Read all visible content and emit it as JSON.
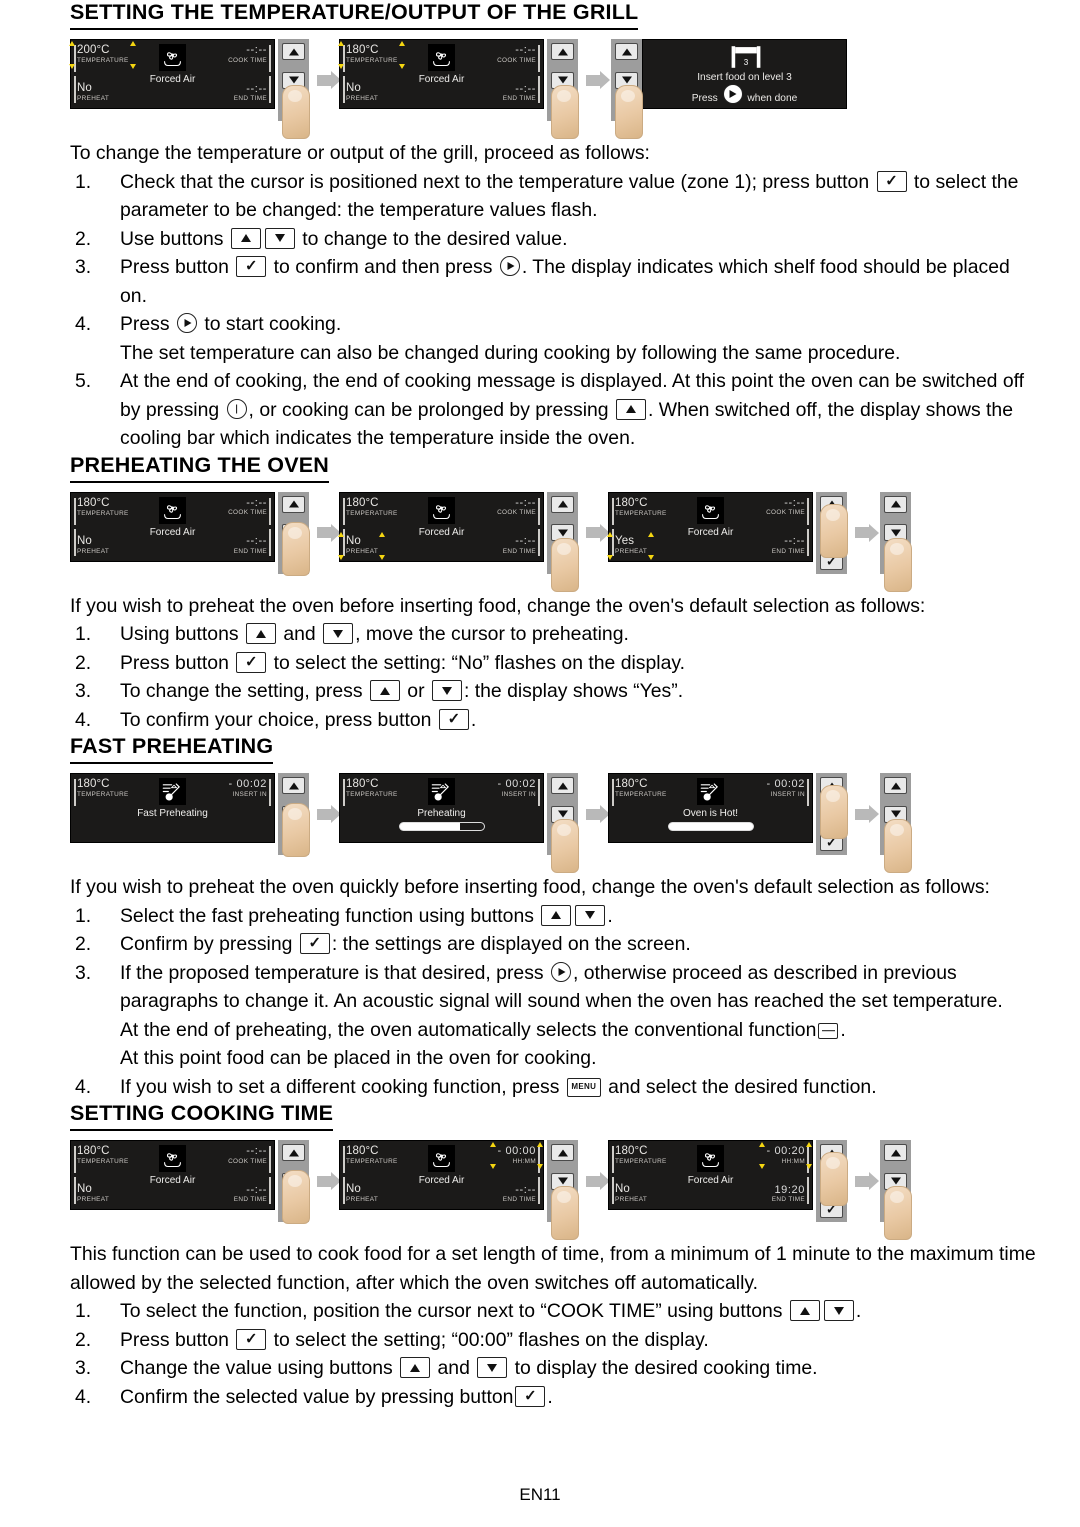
{
  "page": {
    "footer": "EN11"
  },
  "sections": [
    {
      "id": "grill",
      "title": "SETTING THE TEMPERATURE/OUTPUT OF THE GRILL",
      "intro": "To change the temperature or output of the grill, proceed as follows:",
      "steps": [
        {
          "parts": [
            {
              "t": "text",
              "v": "Check that the cursor is positioned next to the temperature value (zone 1); press button "
            },
            {
              "t": "key",
              "v": "ok-button"
            },
            {
              "t": "text",
              "v": " to select the parameter to be changed: the temperature values flash."
            }
          ]
        },
        {
          "parts": [
            {
              "t": "text",
              "v": "Use buttons "
            },
            {
              "t": "key",
              "v": "up-button"
            },
            {
              "t": "key",
              "v": "down-button"
            },
            {
              "t": "text",
              "v": " to change to the desired value."
            }
          ]
        },
        {
          "parts": [
            {
              "t": "text",
              "v": "Press button "
            },
            {
              "t": "key",
              "v": "ok-button"
            },
            {
              "t": "text",
              "v": " to confirm and then press "
            },
            {
              "t": "key",
              "v": "start-button"
            },
            {
              "t": "text",
              "v": ". The display indicates which shelf food should be placed on."
            }
          ]
        },
        {
          "parts": [
            {
              "t": "text",
              "v": "Press "
            },
            {
              "t": "key",
              "v": "start-button"
            },
            {
              "t": "text",
              "v": " to start cooking."
            },
            {
              "t": "br",
              "v": ""
            },
            {
              "t": "text",
              "v": "The set temperature can also be changed during cooking by following the same procedure."
            }
          ]
        },
        {
          "parts": [
            {
              "t": "text",
              "v": "At the end of cooking, the end of cooking message is displayed. At this point the oven can be switched off by pressing "
            },
            {
              "t": "key",
              "v": "power-button"
            },
            {
              "t": "text",
              "v": ", or cooking can be prolonged by pressing "
            },
            {
              "t": "key",
              "v": "up-button"
            },
            {
              "t": "text",
              "v": ". When switched off, the display shows the cooling bar which indicates the temperature inside the oven."
            }
          ]
        }
      ],
      "diagram": {
        "panels": [
          {
            "kind": "display",
            "temperature": "200°C",
            "temperature_label": "TEMPERATURE",
            "cook_time": "--:--",
            "cook_time_label": "COOK TIME",
            "preheat": "No",
            "preheat_label": "PREHEAT",
            "end_time": "--:--",
            "end_time_label": "END TIME",
            "function_icon": "forced-air-icon",
            "function_name": "Forced Air",
            "flash_on": "temperature"
          },
          {
            "kind": "buttons",
            "press": "ok-button"
          },
          {
            "kind": "arrow"
          },
          {
            "kind": "display",
            "temperature": "180°C",
            "temperature_label": "TEMPERATURE",
            "cook_time": "--:--",
            "cook_time_label": "COOK TIME",
            "preheat": "No",
            "preheat_label": "PREHEAT",
            "end_time": "--:--",
            "end_time_label": "END TIME",
            "function_icon": "forced-air-icon",
            "function_name": "Forced Air",
            "flash_on": "temperature"
          },
          {
            "kind": "buttons",
            "press": "ok-button"
          },
          {
            "kind": "arrow"
          },
          {
            "kind": "buttons",
            "press": "ok-button"
          },
          {
            "kind": "message",
            "icon": "shelf-level-icon",
            "line1": "Insert food on level 3",
            "line2_pre": "Press ",
            "line2_key": "start-button",
            "line2_post": " when done"
          }
        ]
      }
    },
    {
      "id": "preheat",
      "title": "PREHEATING THE OVEN",
      "intro": "If you wish to preheat the oven before inserting food, change the oven's default selection as follows:",
      "steps": [
        {
          "parts": [
            {
              "t": "text",
              "v": "Using buttons "
            },
            {
              "t": "key",
              "v": "up-button"
            },
            {
              "t": "text",
              "v": " and "
            },
            {
              "t": "key",
              "v": "down-button"
            },
            {
              "t": "text",
              "v": ", move the cursor to preheating."
            }
          ]
        },
        {
          "parts": [
            {
              "t": "text",
              "v": "Press button "
            },
            {
              "t": "key",
              "v": "ok-button"
            },
            {
              "t": "text",
              "v": " to select the setting: “No” flashes on the display."
            }
          ]
        },
        {
          "parts": [
            {
              "t": "text",
              "v": "To change the setting, press "
            },
            {
              "t": "key",
              "v": "up-button"
            },
            {
              "t": "text",
              "v": " or "
            },
            {
              "t": "key",
              "v": "down-button"
            },
            {
              "t": "text",
              "v": ": the display shows “Yes”."
            }
          ]
        },
        {
          "parts": [
            {
              "t": "text",
              "v": "To confirm your choice, press button "
            },
            {
              "t": "key",
              "v": "ok-button"
            },
            {
              "t": "text",
              "v": "."
            }
          ]
        }
      ],
      "diagram": {
        "panels": [
          {
            "kind": "display",
            "temperature": "180°C",
            "temperature_label": "TEMPERATURE",
            "cook_time": "--:--",
            "cook_time_label": "COOK TIME",
            "preheat": "No",
            "preheat_label": "PREHEAT",
            "end_time": "--:--",
            "end_time_label": "END TIME",
            "function_icon": "forced-air-icon",
            "function_name": "Forced Air",
            "flash_on": "none"
          },
          {
            "kind": "buttons",
            "press": "down-button"
          },
          {
            "kind": "arrow"
          },
          {
            "kind": "display",
            "temperature": "180°C",
            "temperature_label": "TEMPERATURE",
            "cook_time": "--:--",
            "cook_time_label": "COOK TIME",
            "preheat": "No",
            "preheat_label": "PREHEAT",
            "end_time": "--:--",
            "end_time_label": "END TIME",
            "function_icon": "forced-air-icon",
            "function_name": "Forced Air",
            "flash_on": "preheat"
          },
          {
            "kind": "buttons",
            "press": "ok-button"
          },
          {
            "kind": "arrow"
          },
          {
            "kind": "display",
            "temperature": "180°C",
            "temperature_label": "TEMPERATURE",
            "cook_time": "--:--",
            "cook_time_label": "COOK TIME",
            "preheat": "Yes",
            "preheat_label": "PREHEAT",
            "end_time": "--:--",
            "end_time_label": "END TIME",
            "function_icon": "forced-air-icon",
            "function_name": "Forced Air",
            "flash_on": "preheat"
          },
          {
            "kind": "buttons",
            "press": "up-button"
          },
          {
            "kind": "arrow"
          },
          {
            "kind": "buttons",
            "press": "ok-button"
          }
        ]
      }
    },
    {
      "id": "fastpreheat",
      "title": "FAST PREHEATING",
      "intro": "If you wish to preheat the oven quickly before inserting food, change the oven's default selection as follows:",
      "steps": [
        {
          "parts": [
            {
              "t": "text",
              "v": "Select the fast preheating function using buttons "
            },
            {
              "t": "key",
              "v": "up-button"
            },
            {
              "t": "key",
              "v": "down-button"
            },
            {
              "t": "text",
              "v": "."
            }
          ]
        },
        {
          "parts": [
            {
              "t": "text",
              "v": "Confirm by pressing "
            },
            {
              "t": "key",
              "v": "ok-button"
            },
            {
              "t": "text",
              "v": ": the settings are displayed on the screen."
            }
          ]
        },
        {
          "parts": [
            {
              "t": "text",
              "v": "If the proposed temperature is that desired, press "
            },
            {
              "t": "key",
              "v": "start-button"
            },
            {
              "t": "text",
              "v": ", otherwise proceed as described in previous paragraphs to change it. An acoustic signal will sound when the oven has reached the set temperature."
            },
            {
              "t": "br",
              "v": ""
            },
            {
              "t": "text",
              "v": "At the end of preheating, the oven automatically selects the conventional function"
            },
            {
              "t": "key",
              "v": "conventional-icon"
            },
            {
              "t": "text",
              "v": "."
            },
            {
              "t": "br",
              "v": ""
            },
            {
              "t": "text",
              "v": "At this point food can be placed in the oven for cooking."
            }
          ]
        },
        {
          "parts": [
            {
              "t": "text",
              "v": "If you wish to set a different cooking function, press "
            },
            {
              "t": "key",
              "v": "menu-button"
            },
            {
              "t": "text",
              "v": " and select the desired function."
            }
          ]
        }
      ],
      "diagram": {
        "panels": [
          {
            "kind": "display",
            "temperature": "180°C",
            "temperature_label": "TEMPERATURE",
            "cook_time": "- 00:02",
            "cook_time_label": "INSERT IN",
            "preheat": "",
            "preheat_label": "",
            "end_time": "",
            "end_time_label": "",
            "function_icon": "thermometer-icon",
            "function_name": "Fast Preheating",
            "flash_on": "none"
          },
          {
            "kind": "buttons",
            "press": "down-button"
          },
          {
            "kind": "arrow"
          },
          {
            "kind": "display",
            "temperature": "180°C",
            "temperature_label": "TEMPERATURE",
            "cook_time": "- 00:02",
            "cook_time_label": "INSERT IN",
            "preheat": "",
            "preheat_label": "",
            "end_time": "",
            "end_time_label": "",
            "function_icon": "thermometer-icon",
            "function_name": "Preheating",
            "progress": 72,
            "flash_on": "none"
          },
          {
            "kind": "buttons",
            "press": "ok-button"
          },
          {
            "kind": "arrow"
          },
          {
            "kind": "display",
            "temperature": "180°C",
            "temperature_label": "TEMPERATURE",
            "cook_time": "- 00:02",
            "cook_time_label": "INSERT IN",
            "preheat": "",
            "preheat_label": "",
            "end_time": "",
            "end_time_label": "",
            "function_icon": "thermometer-icon",
            "function_name": "Oven is Hot!",
            "progress": 100,
            "flash_on": "none"
          },
          {
            "kind": "buttons",
            "press": "up-button"
          },
          {
            "kind": "arrow"
          },
          {
            "kind": "buttons",
            "press": "ok-button"
          }
        ]
      }
    },
    {
      "id": "cooktime",
      "title": "SETTING COOKING TIME",
      "intro": "This function can be used to cook food for a set length of time, from a minimum of 1 minute to the maximum time allowed by the selected function, after which the oven switches off automatically.",
      "steps": [
        {
          "parts": [
            {
              "t": "text",
              "v": "To select the function, position the cursor next to “COOK TIME” using buttons "
            },
            {
              "t": "key",
              "v": "up-button"
            },
            {
              "t": "key",
              "v": "down-button"
            },
            {
              "t": "text",
              "v": "."
            }
          ]
        },
        {
          "parts": [
            {
              "t": "text",
              "v": "Press button "
            },
            {
              "t": "key",
              "v": "ok-button"
            },
            {
              "t": "text",
              "v": " to select the setting; “00:00” flashes on the display."
            }
          ]
        },
        {
          "parts": [
            {
              "t": "text",
              "v": "Change the value using buttons "
            },
            {
              "t": "key",
              "v": "up-button"
            },
            {
              "t": "text",
              "v": " and "
            },
            {
              "t": "key",
              "v": "down-button"
            },
            {
              "t": "text",
              "v": " to display the desired cooking time."
            }
          ]
        },
        {
          "parts": [
            {
              "t": "text",
              "v": "Confirm the selected value by pressing button"
            },
            {
              "t": "key",
              "v": "ok-button"
            },
            {
              "t": "text",
              "v": "."
            }
          ]
        }
      ],
      "diagram": {
        "panels": [
          {
            "kind": "display",
            "temperature": "180°C",
            "temperature_label": "TEMPERATURE",
            "cook_time": "--:--",
            "cook_time_label": "COOK TIME",
            "preheat": "No",
            "preheat_label": "PREHEAT",
            "end_time": "--:--",
            "end_time_label": "END TIME",
            "function_icon": "forced-air-icon",
            "function_name": "Forced Air",
            "flash_on": "none"
          },
          {
            "kind": "buttons",
            "press": "down-button"
          },
          {
            "kind": "arrow"
          },
          {
            "kind": "display",
            "temperature": "180°C",
            "temperature_label": "TEMPERATURE",
            "cook_time": "- 00:00",
            "cook_time_label": "HH:MM",
            "preheat": "No",
            "preheat_label": "PREHEAT",
            "end_time": "--:--",
            "end_time_label": "END TIME",
            "function_icon": "forced-air-icon",
            "function_name": "Forced Air",
            "flash_on": "cooktime"
          },
          {
            "kind": "buttons",
            "press": "ok-button"
          },
          {
            "kind": "arrow"
          },
          {
            "kind": "display",
            "temperature": "180°C",
            "temperature_label": "TEMPERATURE",
            "cook_time": "- 00:20",
            "cook_time_label": "HH:MM",
            "preheat": "No",
            "preheat_label": "PREHEAT",
            "end_time": "19:20",
            "end_time_label": "END TIME",
            "function_icon": "forced-air-icon",
            "function_name": "Forced Air",
            "flash_on": "cooktime"
          },
          {
            "kind": "buttons",
            "press": "up-button"
          },
          {
            "kind": "arrow"
          },
          {
            "kind": "buttons",
            "press": "ok-button"
          }
        ]
      }
    }
  ]
}
